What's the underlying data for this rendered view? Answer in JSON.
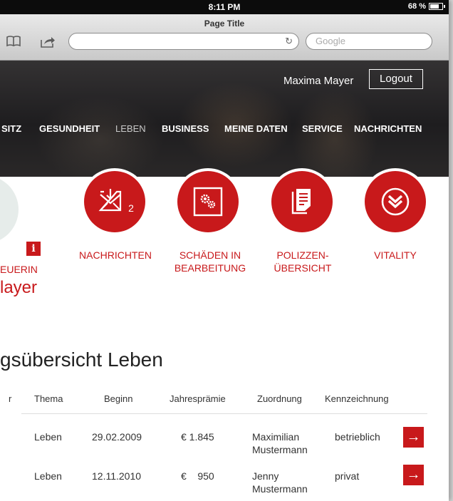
{
  "status_bar": {
    "time": "8:11 PM",
    "battery": "68 %"
  },
  "browser": {
    "page_title": "Page Title",
    "url": "",
    "search_placeholder": "Google"
  },
  "header": {
    "user_name": "Maxima Mayer",
    "logout_label": "Logout",
    "nav": [
      "SITZ",
      "GESUNDHEIT",
      "LEBEN",
      "BUSINESS",
      "MEINE DATEN",
      "SERVICE",
      "NACHRICHTEN"
    ]
  },
  "quick_links": [
    {
      "line1": "NACHRICHTEN",
      "line2": "",
      "badge": "2",
      "icon": "mail-download-icon"
    },
    {
      "line1": "SCHÄDEN IN",
      "line2": "BEARBEITUNG",
      "icon": "gears-icon"
    },
    {
      "line1": "POLIZZEN-",
      "line2": "ÜBERSICHT",
      "icon": "documents-icon"
    },
    {
      "line1": "VITALITY",
      "line2": "",
      "icon": "chevron-shield-icon"
    }
  ],
  "left_panel": {
    "info_badge": "i",
    "label": "EUERIN",
    "name_fragment": "layer"
  },
  "section": {
    "title": "gsübersicht Leben"
  },
  "table": {
    "headers": [
      "r",
      "Thema",
      "Beginn",
      "Jahresprämie",
      "Zuordnung",
      "Kennzeichnung"
    ],
    "rows": [
      {
        "thema": "Leben",
        "beginn": "29.02.2009",
        "praemie": "€ 1.845",
        "zuordnung1": "Maximilian",
        "zuordnung2": "Mustermann",
        "kennzeichnung": "betrieblich"
      },
      {
        "thema": "Leben",
        "beginn": "12.11.2010",
        "praemie": "€    950",
        "zuordnung1": "Jenny",
        "zuordnung2": "Mustermann",
        "kennzeichnung": "privat"
      }
    ]
  },
  "colors": {
    "brand_red": "#c8191b"
  }
}
